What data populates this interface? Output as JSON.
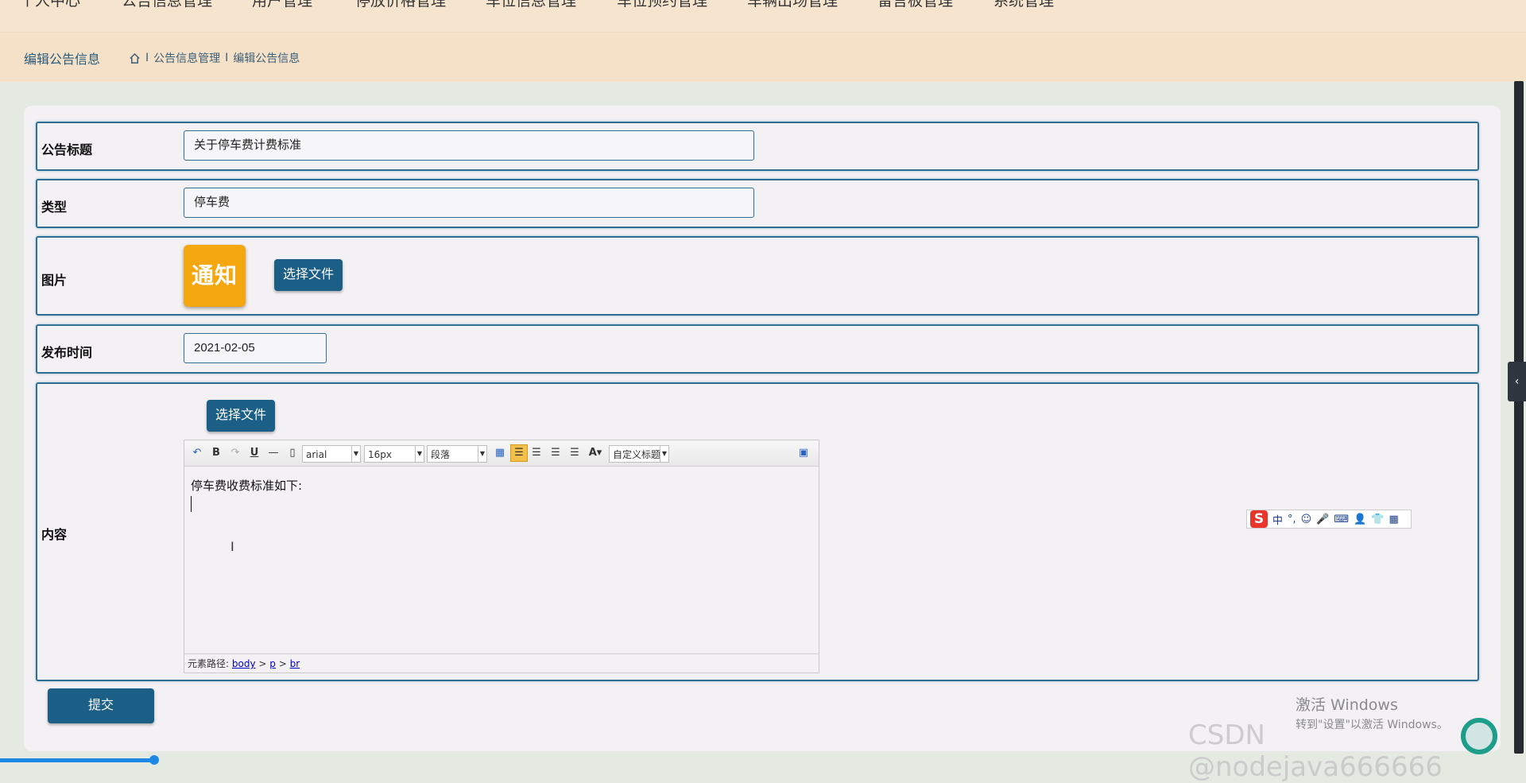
{
  "topnav": {
    "items": [
      "个人中心",
      "公告信息管理",
      "用户管理",
      "停放价格管理",
      "车位信息管理",
      "车位预约管理",
      "车辆出场管理",
      "留言板管理",
      "系统管理"
    ]
  },
  "breadcrumb": {
    "title": "编辑公告信息",
    "path": [
      "公告信息管理",
      "编辑公告信息"
    ],
    "separator": "I"
  },
  "form": {
    "title_label": "公告标题",
    "title_value": "关于停车费计费标准",
    "type_label": "类型",
    "type_value": "停车费",
    "image_label": "图片",
    "image_text": "通知",
    "choose_file": "选择文件",
    "time_label": "发布时间",
    "time_value": "2021-02-05",
    "content_label": "内容",
    "content_choose_file": "选择文件",
    "submit": "提交"
  },
  "editor": {
    "font": "arial",
    "size": "16px",
    "paragraph": "段落",
    "custom_title": "自定义标题",
    "bold": "B",
    "underline": "U",
    "font_color": "A",
    "body_text": "停车费收费标准如下:",
    "path_label": "元素路径:",
    "path_items": [
      "body",
      "p",
      "br"
    ],
    "path_sep": ">"
  },
  "ime": {
    "logo": "S",
    "lang": "中"
  },
  "watermark": {
    "windows_title": "激活 Windows",
    "windows_sub": "转到\"设置\"以激活 Windows。",
    "csdn": "CSDN @nodejava666666"
  },
  "colors": {
    "accent": "#1b5f87",
    "border": "#2f6f94",
    "header_bg": "#f5e0c8",
    "notice_bg": "#f4a70e"
  }
}
